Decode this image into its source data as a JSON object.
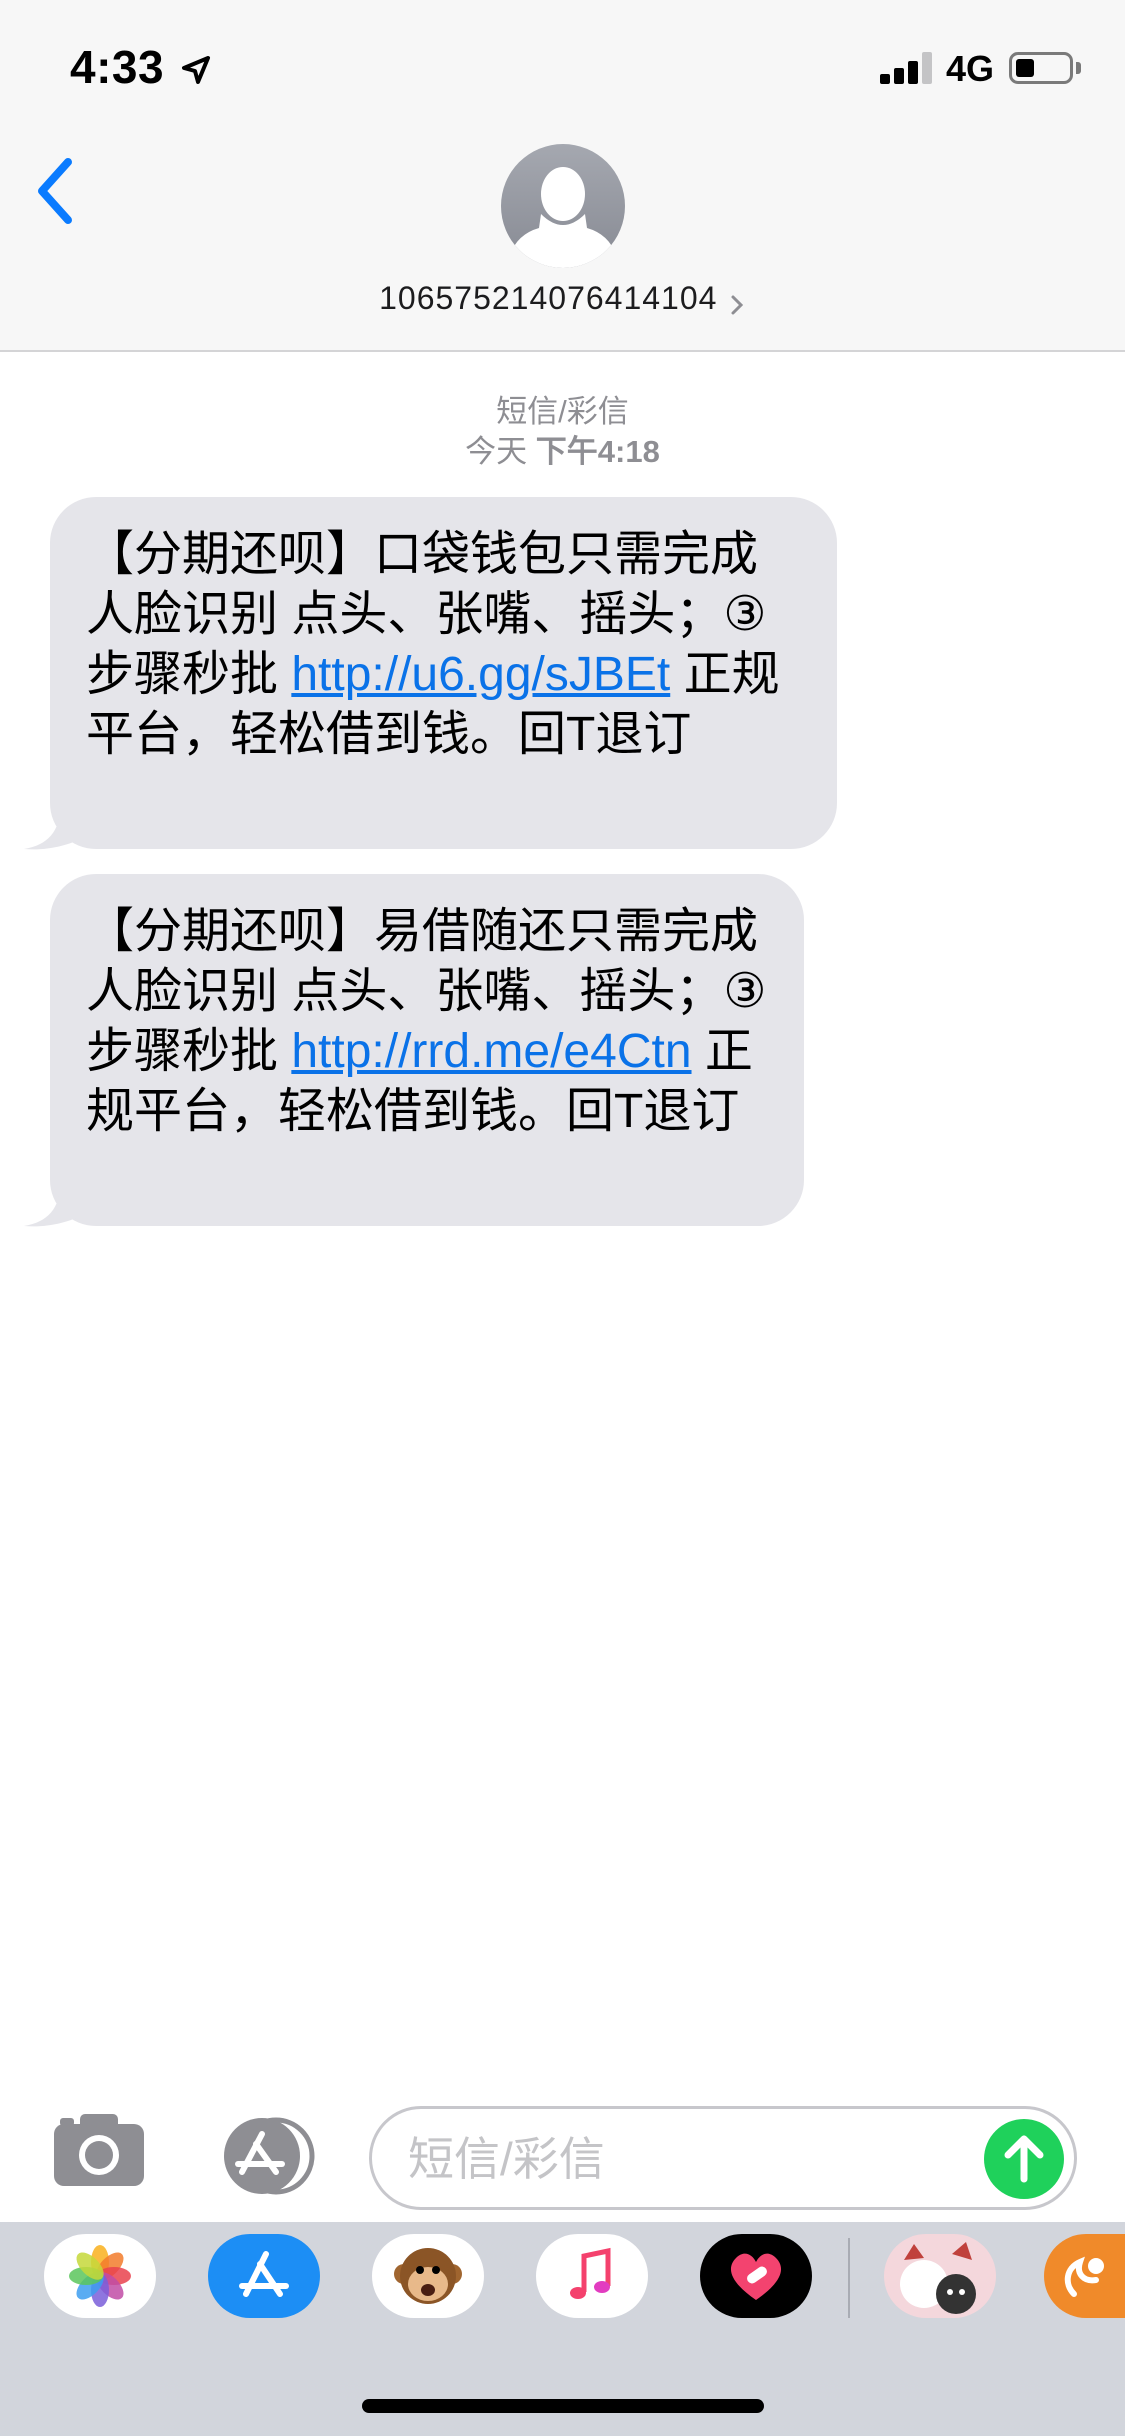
{
  "status_bar": {
    "time": "4:33",
    "network": "4G",
    "signal_bars_active": 3,
    "signal_bars_total": 4,
    "battery_level": 0.25
  },
  "header": {
    "contact_number": "106575214076414104",
    "back_icon": "chevron-left-icon",
    "avatar_icon": "person-silhouette-icon",
    "detail_icon": "chevron-right-icon"
  },
  "conversation": {
    "service_label": "短信/彩信",
    "date_label": "今天",
    "time_label": "下午4:18",
    "messages": [
      {
        "text_before": "【分期还呗】口袋钱包只需完成人脸识别 点头、张嘴、摇头；③步骤秒批 ",
        "link": "http://u6.gg/sJBEt",
        "text_after": " 正规平台，轻松借到钱。回T退订"
      },
      {
        "text_before": "【分期还呗】易借随还只需完成人脸识别 点头、张嘴、摇头；③步骤秒批 ",
        "link": "http://rrd.me/e4Ctn",
        "text_after": " 正规平台，轻松借到钱。回T退订"
      }
    ]
  },
  "input_bar": {
    "placeholder": "短信/彩信",
    "camera_icon": "camera-icon",
    "apps_icon": "app-store-icon",
    "send_icon": "arrow-up-icon"
  },
  "app_drawer": {
    "apps": [
      "photos-icon",
      "app-store-icon",
      "animoji-monkey-icon",
      "music-icon",
      "digital-touch-icon",
      "sticker-app-icon",
      "uc-browser-icon"
    ]
  },
  "colors": {
    "accent_blue": "#0a72e8",
    "bubble_gray": "#e5e5ea",
    "send_green": "#1fd15b",
    "meta_gray": "#8e8e93"
  }
}
